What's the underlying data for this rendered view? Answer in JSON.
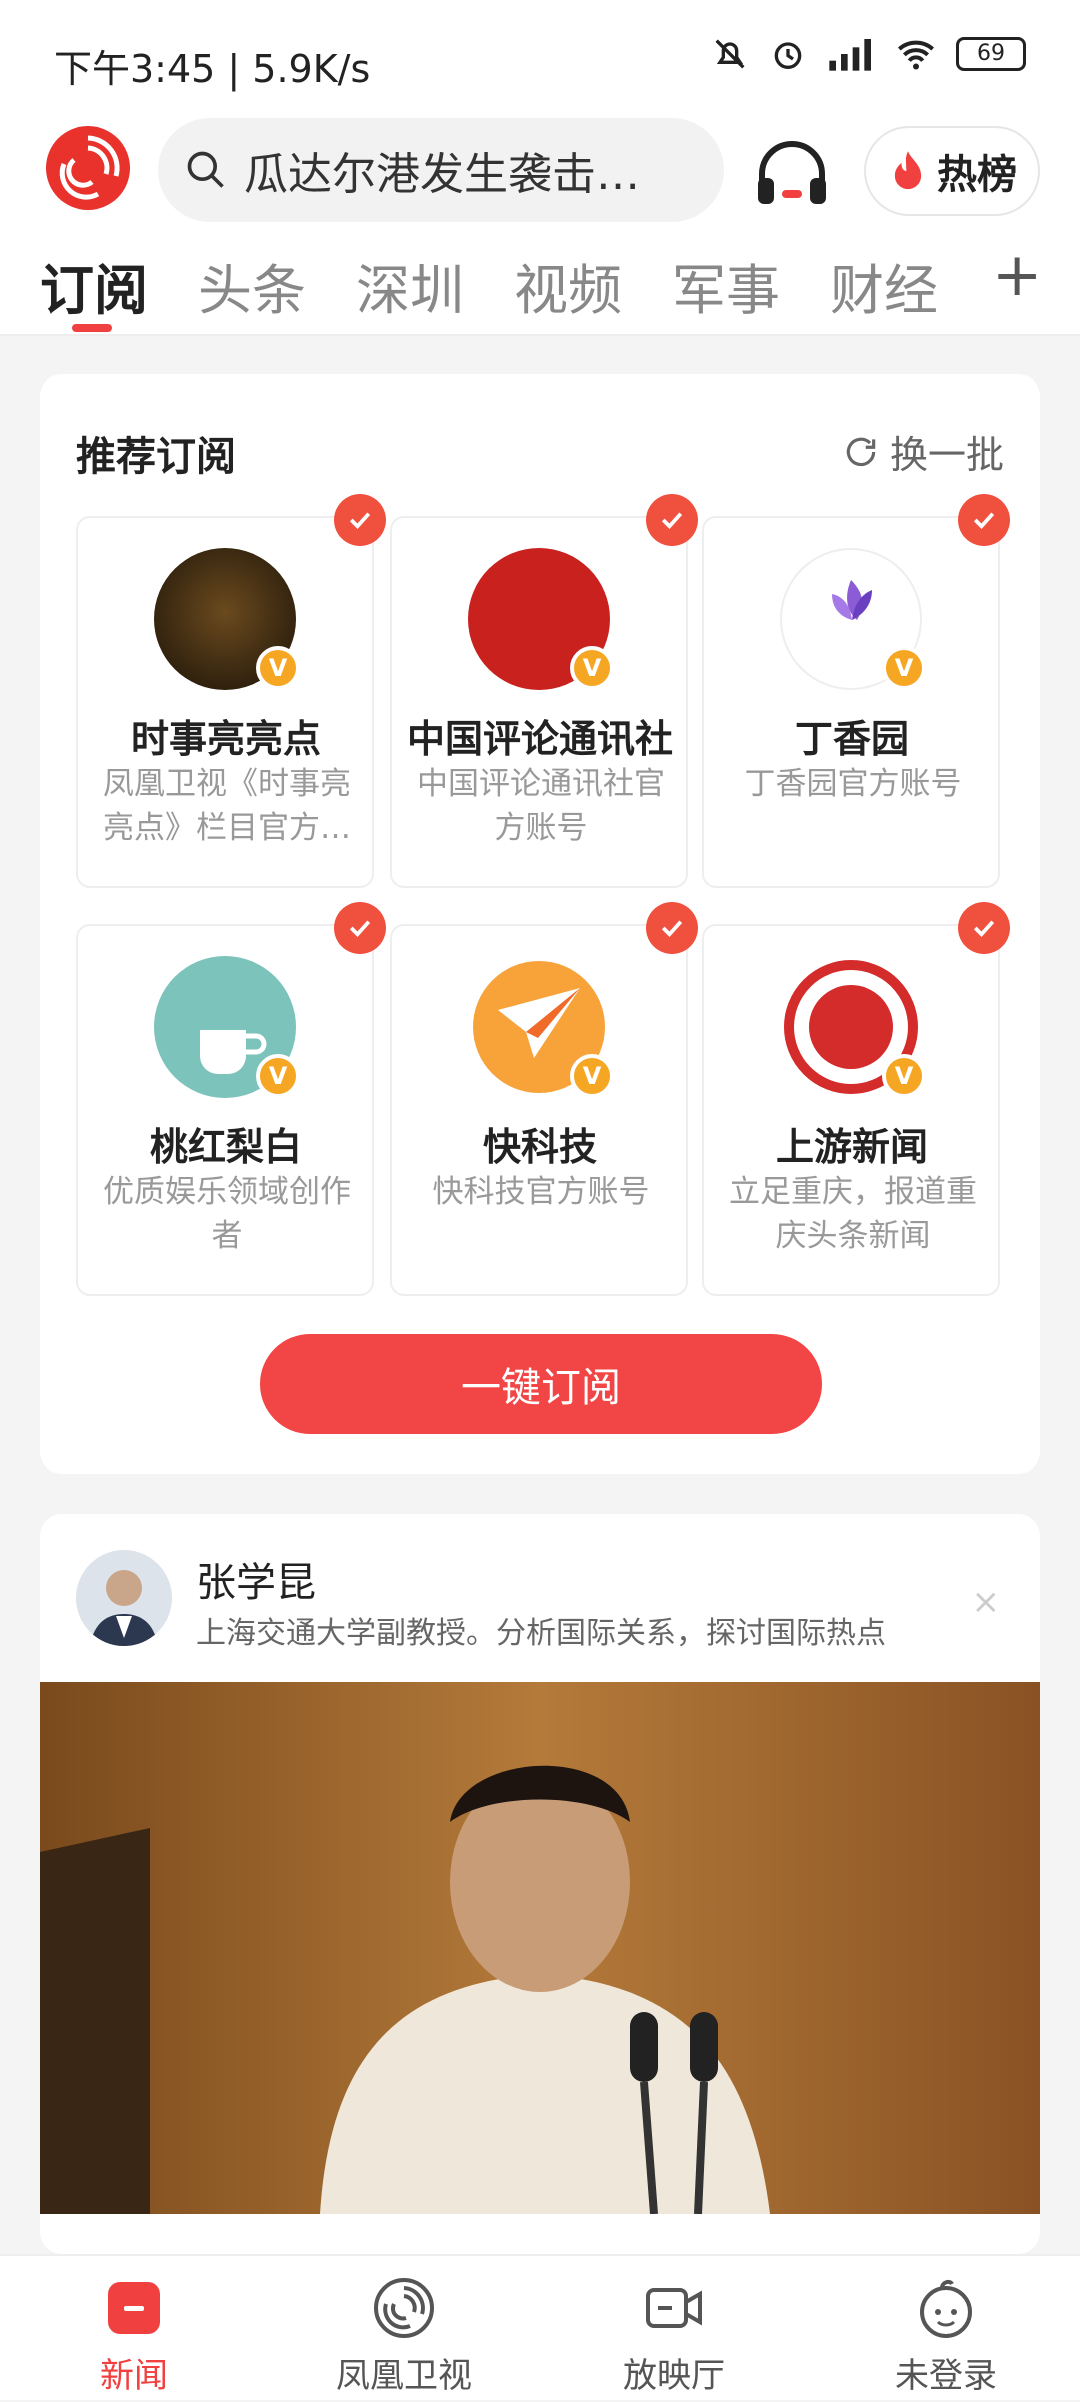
{
  "status_bar": {
    "time": "下午3:45 | 5.9K/s",
    "battery": "69"
  },
  "header": {
    "search_placeholder": "瓜达尔港发生袭击…",
    "hot_label": "热榜"
  },
  "tabs": [
    {
      "label": "订阅",
      "active": true
    },
    {
      "label": "头条"
    },
    {
      "label": "深圳"
    },
    {
      "label": "视频"
    },
    {
      "label": "军事"
    },
    {
      "label": "财经"
    }
  ],
  "tabs_plus": "+",
  "recommend": {
    "title": "推荐订阅",
    "refresh_label": "换一批",
    "accounts": [
      {
        "name": "时事亮亮点",
        "desc": "凤凰卫视《时事亮亮点》栏目官方账号"
      },
      {
        "name": "中国评论通讯社",
        "desc": "中国评论通讯社官方账号"
      },
      {
        "name": "丁香园",
        "desc": "丁香园官方账号"
      },
      {
        "name": "桃红梨白",
        "desc": "优质娱乐领域创作者"
      },
      {
        "name": "快科技",
        "desc": "快科技官方账号"
      },
      {
        "name": "上游新闻",
        "desc": "立足重庆，报道重庆头条新闻"
      }
    ],
    "verified_badge": "V",
    "subscribe_all": "一键订阅"
  },
  "post": {
    "author": "张学昆",
    "author_desc": "上海交通大学副教授。分析国际关系，探讨国际热点",
    "close": "×"
  },
  "bottom_nav": [
    {
      "label": "新闻",
      "icon": "news-icon",
      "active": true
    },
    {
      "label": "凤凰卫视",
      "icon": "phoenix-tv-icon"
    },
    {
      "label": "放映厅",
      "icon": "video-camera-icon"
    },
    {
      "label": "未登录",
      "icon": "user-icon"
    }
  ],
  "colors": {
    "accent": "#f04040",
    "badge": "#f5a623"
  }
}
